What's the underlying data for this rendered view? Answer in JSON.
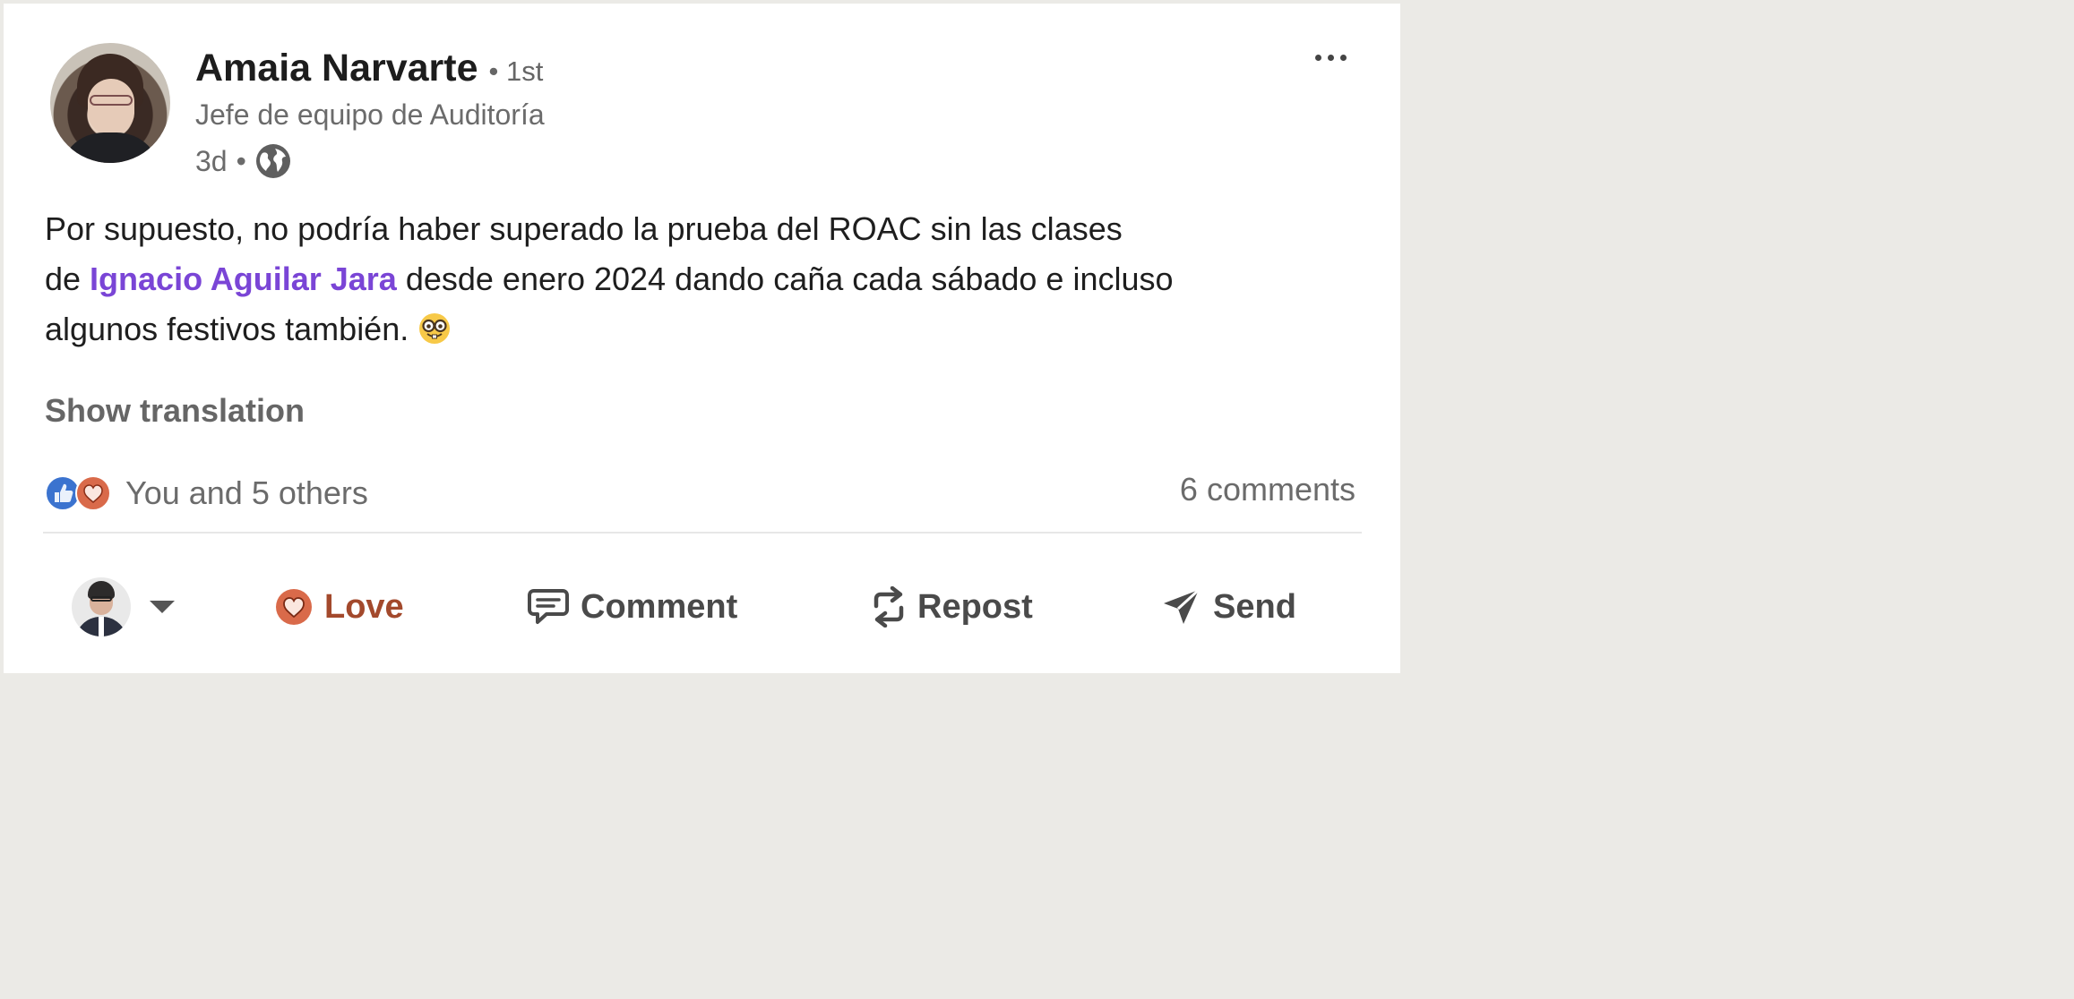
{
  "post": {
    "author": {
      "name": "Amaia Narvarte",
      "degree": "• 1st",
      "headline": "Jefe de equipo de Auditoría",
      "age": "3d",
      "visibility_separator": "•",
      "visibility_icon": "globe-icon"
    },
    "text": {
      "line1": "Por supuesto, no podría haber superado la prueba del ROAC sin las clases",
      "line2_prefix": "de ",
      "mention": "Ignacio Aguilar Jara",
      "line2_suffix": " desde enero 2024 dando caña cada sábado e incluso",
      "line3": "algunos festivos también. ",
      "emoji": "nerd-face-emoji"
    },
    "show_translation": "Show translation",
    "more_menu_icon": "ellipsis-icon"
  },
  "social": {
    "reactions_text": "You and 5 others",
    "reaction_icons": [
      "like-icon",
      "love-icon"
    ],
    "comments_text": "6 comments"
  },
  "actions": {
    "love_label": "Love",
    "comment_label": "Comment",
    "repost_label": "Repost",
    "send_label": "Send"
  },
  "colors": {
    "mention": "#7a45d6",
    "love": "#a3492c",
    "like": "#3b73cf",
    "muted_text": "#6b6b6b"
  }
}
